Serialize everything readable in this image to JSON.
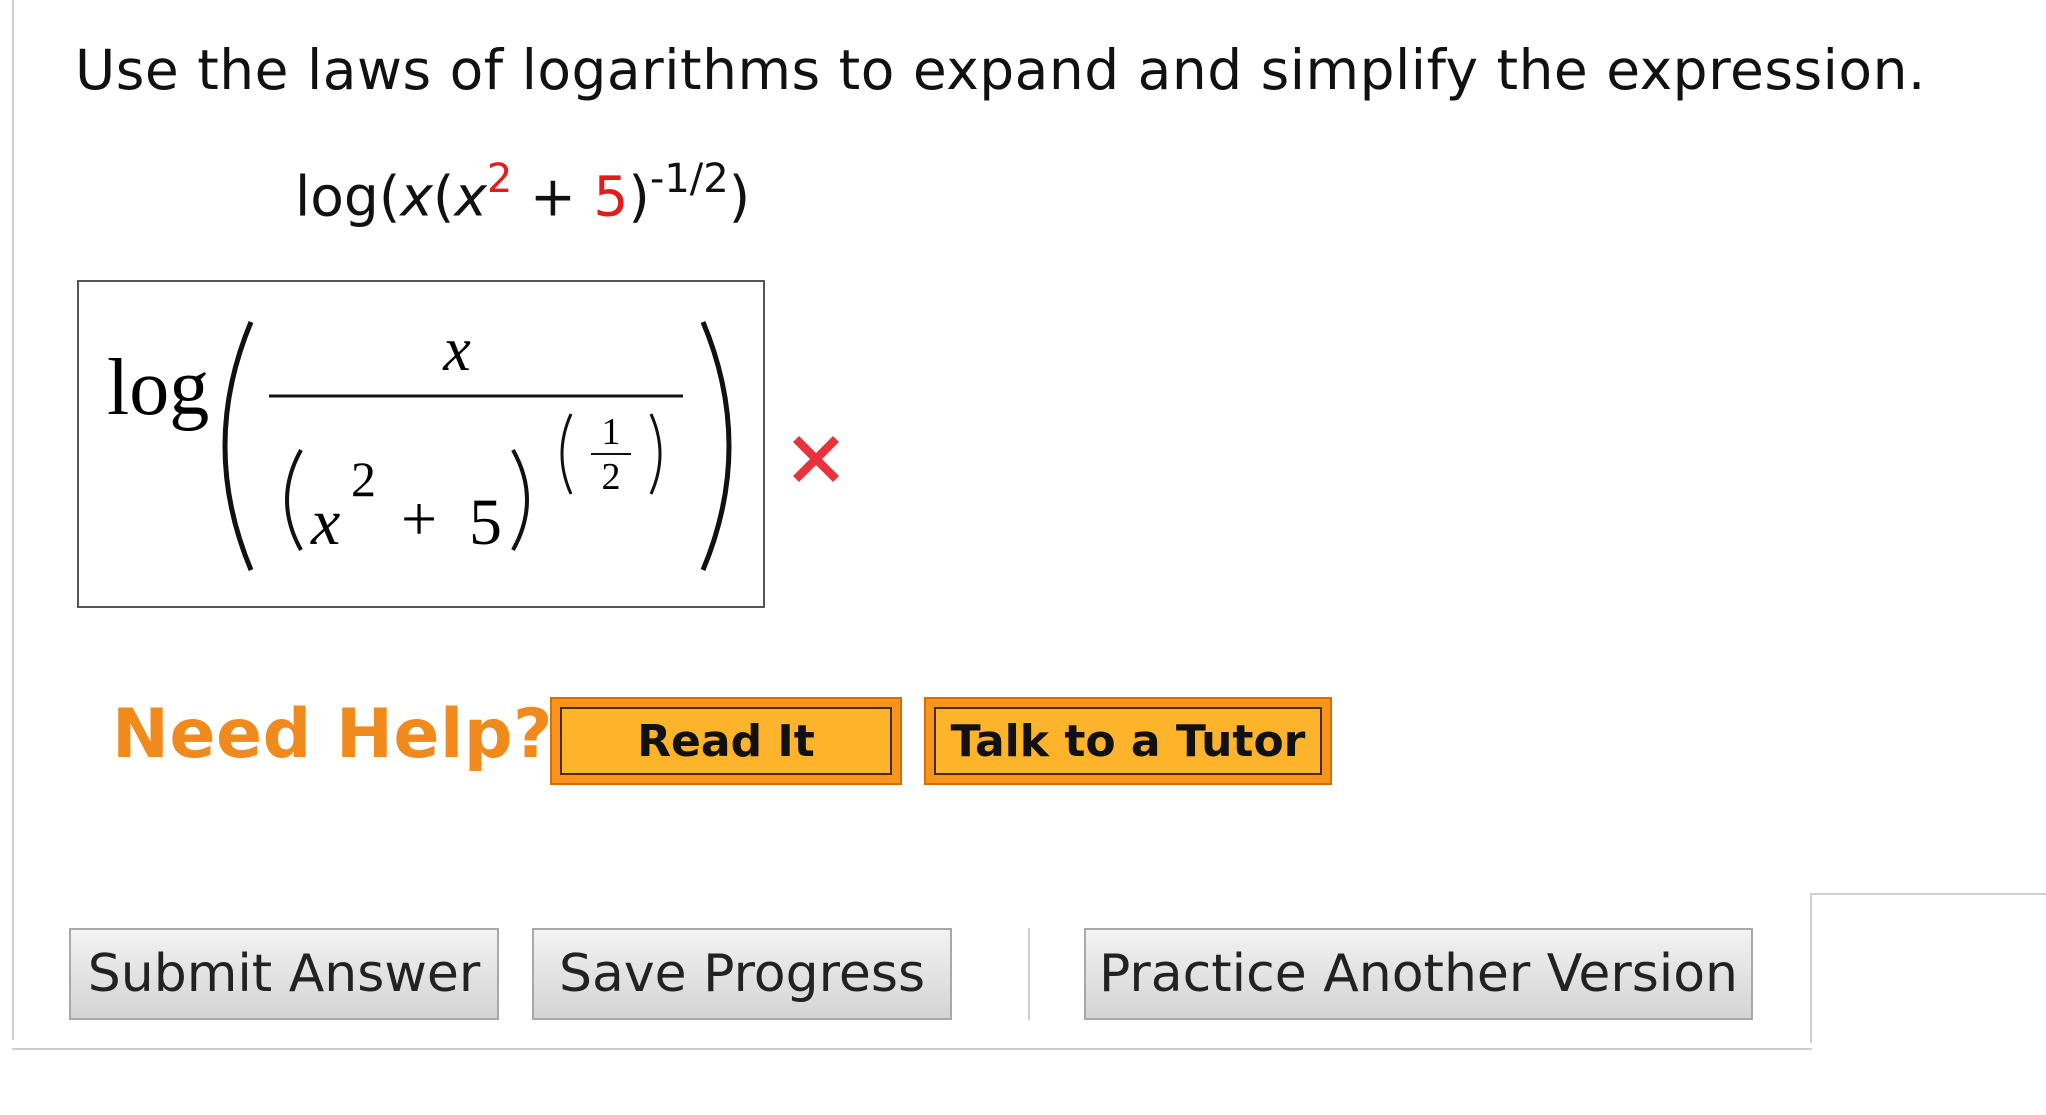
{
  "question": {
    "prompt": "Use the laws of logarithms to expand and simplify the expression.",
    "expression": {
      "func": "log",
      "open": "(",
      "var_x": "x",
      "open2": "(",
      "var_x2": "x",
      "exp2": "2",
      "plus": " + ",
      "const": "5",
      "close": ")",
      "outer_exp": "-1/2",
      "close_final": ")"
    }
  },
  "answer": {
    "log": "log",
    "numerator": "x",
    "denom_var": "x",
    "denom_exp": "2",
    "denom_plus": "+",
    "denom_const": "5",
    "frac_num": "1",
    "frac_den": "2"
  },
  "status": {
    "icon": "x-mark-icon",
    "color": "#e8333f"
  },
  "help": {
    "label": "Need Help?",
    "read_it": "Read It",
    "talk_tutor": "Talk to a Tutor"
  },
  "actions": {
    "submit": "Submit Answer",
    "save": "Save Progress",
    "practice": "Practice Another Version"
  },
  "colors": {
    "help_orange": "#f08a1c",
    "button_fill": "#fdb32a",
    "error_red": "#e8333f",
    "highlight_red": "#e31b1b"
  }
}
